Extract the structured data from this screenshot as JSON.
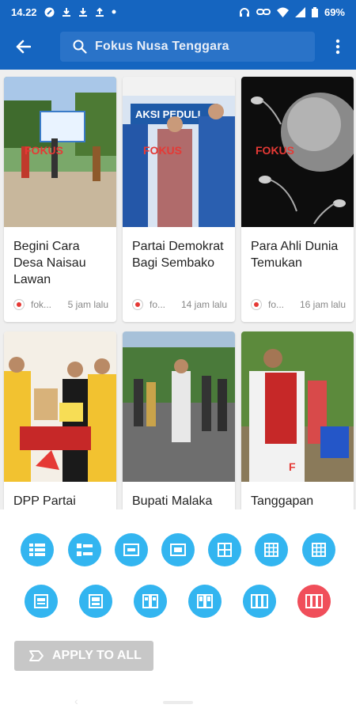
{
  "status_bar": {
    "time": "14.22",
    "battery": "69%"
  },
  "app_bar": {
    "search_text": "Fokus Nusa Tenggara"
  },
  "cards": [
    {
      "title": "Begini Cara Desa Naisau Lawan",
      "source": "fok...",
      "time": "5 jam lalu"
    },
    {
      "title": "Partai Demokrat Bagi Sembako",
      "source": "fo...",
      "time": "14 jam lalu"
    },
    {
      "title": "Para Ahli Dunia Temukan",
      "source": "fo...",
      "time": "16 jam lalu"
    },
    {
      "title": "DPP Partai",
      "source": "",
      "time": ""
    },
    {
      "title": "Bupati Malaka",
      "source": "",
      "time": ""
    },
    {
      "title": "Tanggapan",
      "source": "",
      "time": ""
    }
  ],
  "layout_options": {
    "row1": [
      "list-small-icon",
      "list-medium-icon",
      "card-wide-icon",
      "card-wide-icon",
      "grid-2x2-icon",
      "grid-3x3-icon",
      "grid-3x3-icon"
    ],
    "row2": [
      "single-card-icon",
      "single-card-icon",
      "columns-2-icon",
      "columns-2-icon",
      "columns-3-icon",
      "columns-3-selected-icon"
    ],
    "selected_color": "#f04e5a",
    "default_color": "#33b5f0"
  },
  "apply_button": {
    "label": "APPLY TO ALL"
  }
}
